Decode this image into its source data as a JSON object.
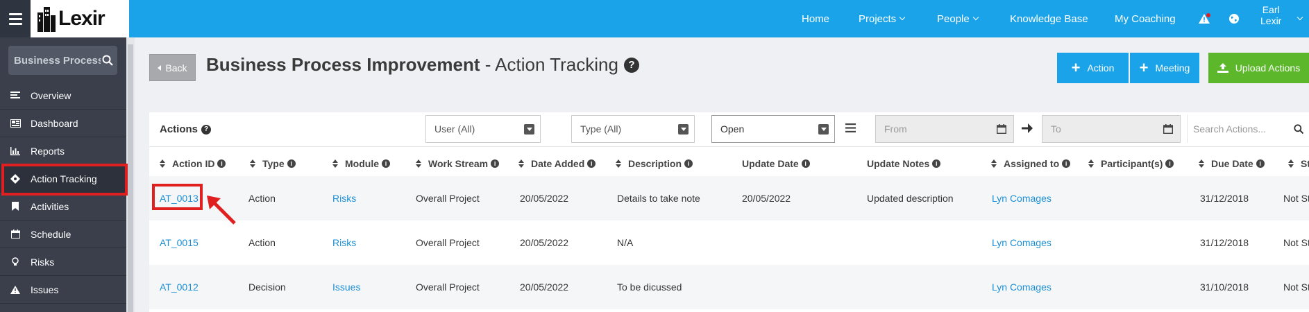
{
  "app": {
    "logo_text": "Lexir"
  },
  "topnav": {
    "home": "Home",
    "projects": "Projects",
    "people": "People",
    "knowledge_base": "Knowledge Base",
    "my_coaching": "My Coaching",
    "user_first": "Earl",
    "user_last": "Lexir"
  },
  "sidebar": {
    "search_value": "Business Process Improvement",
    "items": [
      {
        "label": "Overview"
      },
      {
        "label": "Dashboard"
      },
      {
        "label": "Reports"
      },
      {
        "label": "Action Tracking"
      },
      {
        "label": "Activities"
      },
      {
        "label": "Schedule"
      },
      {
        "label": "Risks"
      },
      {
        "label": "Issues"
      }
    ]
  },
  "header": {
    "back_label": "Back",
    "title_bold": "Business Process Improvement",
    "title_rest": " - Action Tracking",
    "help_glyph": "?",
    "action_btn": "Action",
    "meeting_btn": "Meeting",
    "upload_btn": "Upload Actions"
  },
  "filters": {
    "panel_title": "Actions",
    "user": "User (All)",
    "type": "Type (All)",
    "status": "Open",
    "from_placeholder": "From",
    "to_placeholder": "To",
    "search_placeholder": "Search Actions..."
  },
  "table": {
    "columns": [
      "Action ID",
      "Type",
      "Module",
      "Work Stream",
      "Date Added",
      "Description",
      "Update Date",
      "Update Notes",
      "Assigned to",
      "Participant(s)",
      "Due Date",
      "Sta"
    ],
    "rows": [
      {
        "id": "AT_0013",
        "type": "Action",
        "module": "Risks",
        "stream": "Overall Project",
        "added": "20/05/2022",
        "desc": "Details to take note",
        "updated": "20/05/2022",
        "notes": "Updated description",
        "assigned": "Lyn Comages",
        "participants": "",
        "due": "31/12/2018",
        "status": "Not St"
      },
      {
        "id": "AT_0015",
        "type": "Action",
        "module": "Risks",
        "stream": "Overall Project",
        "added": "20/05/2022",
        "desc": "N/A",
        "updated": "",
        "notes": "",
        "assigned": "Lyn Comages",
        "participants": "",
        "due": "31/12/2018",
        "status": "Not St"
      },
      {
        "id": "AT_0012",
        "type": "Decision",
        "module": "Issues",
        "stream": "Overall Project",
        "added": "20/05/2022",
        "desc": "To be dicussed",
        "updated": "",
        "notes": "",
        "assigned": "Lyn Comages",
        "participants": "",
        "due": "31/10/2018",
        "status": "Not St"
      }
    ]
  },
  "colors": {
    "topbar": "#1aa3e8",
    "sidebar": "#3a3f4b",
    "action_blue": "#1aa3e8",
    "upload_green": "#5cb82a",
    "highlight_red": "#e02020",
    "link": "#1a8fd4"
  }
}
